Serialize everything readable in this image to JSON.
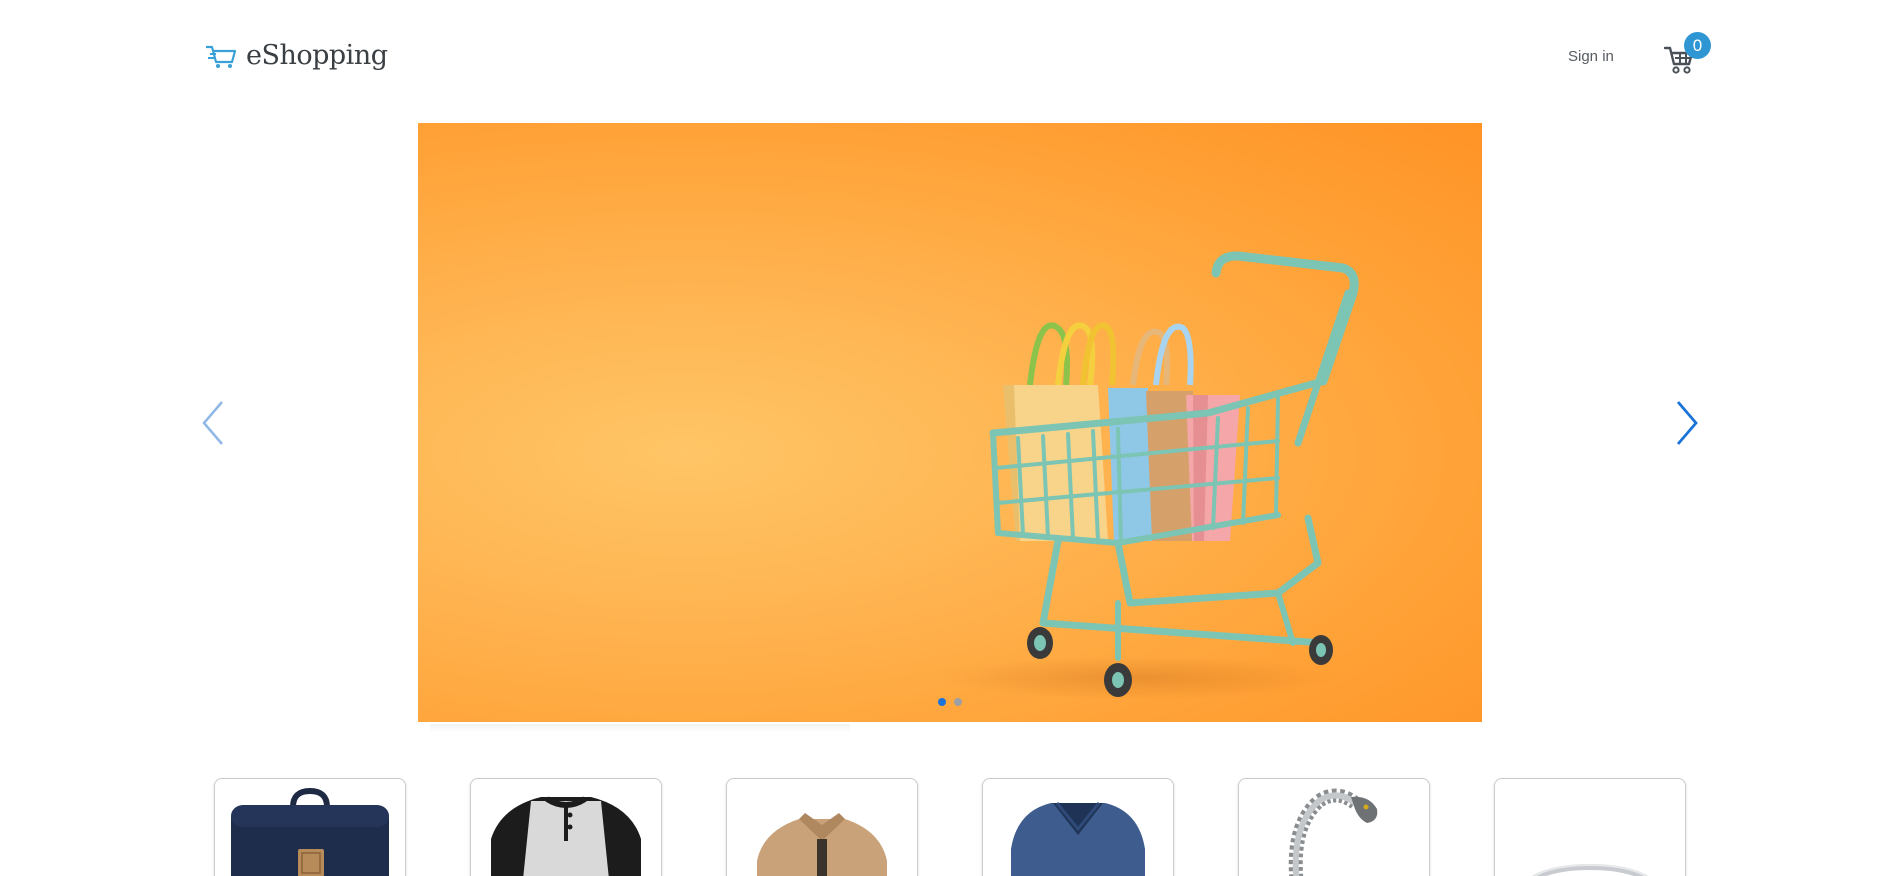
{
  "header": {
    "logo_text": "eShopping",
    "sign_in_label": "Sign in",
    "cart_count": "0"
  },
  "carousel": {
    "slides_total": 2,
    "active_slide": 1,
    "slide_image": "shopping-cart-with-bags-on-orange",
    "prev_icon": "chevron-left-icon",
    "next_icon": "chevron-right-icon"
  },
  "products": [
    {
      "image": "navy-backpack"
    },
    {
      "image": "black-white-henley-shirt"
    },
    {
      "image": "beige-jacket"
    },
    {
      "image": "blue-vneck-sweater"
    },
    {
      "image": "silver-dragon-bracelet"
    },
    {
      "image": "silver-ring"
    }
  ],
  "colors": {
    "accent": "#2f96d4",
    "arrow_next": "#1a73d8",
    "arrow_prev": "#8fb8e6",
    "banner_orange": "#ffa237",
    "cart_teal": "#7cc4b4"
  }
}
